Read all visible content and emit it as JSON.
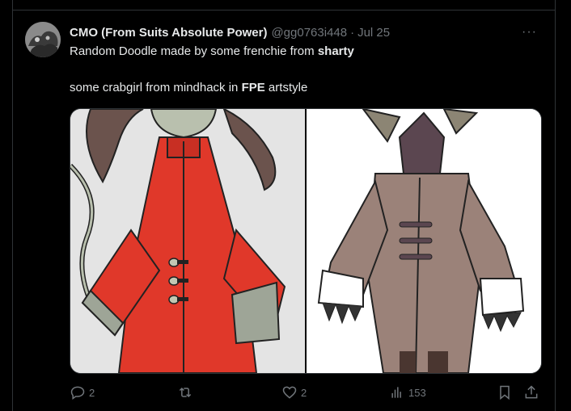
{
  "tweet": {
    "author_name": "CMO (From Suits Absolute Power)",
    "handle": "@gg0763i448",
    "separator": "·",
    "date": "Jul 25",
    "more_label": "···",
    "line1_prefix": "Random Doodle made by some frenchie from ",
    "line1_bold": "sharty",
    "line2_prefix": "some crabgirl from mindhack in ",
    "line2_bold": "FPE",
    "line2_suffix": " artstyle"
  },
  "media": {
    "left_description_icon": "red-coat-character-image",
    "right_description_icon": "brown-coat-character-image"
  },
  "actions": {
    "reply_count": "2",
    "retweet_count": "",
    "like_count": "2",
    "views_count": "153"
  },
  "colors": {
    "background": "#000000",
    "text": "#e7e9ea",
    "muted": "#71767b",
    "border": "#2f3336"
  }
}
